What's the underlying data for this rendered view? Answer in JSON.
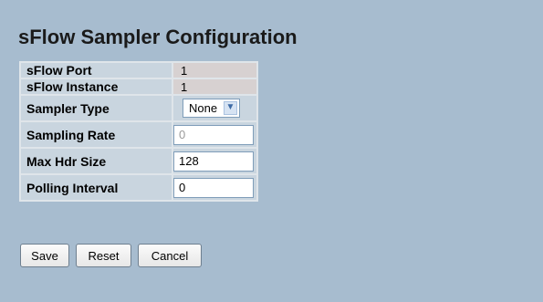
{
  "title": "sFlow Sampler Configuration",
  "form": {
    "rows": [
      {
        "label": "sFlow Port",
        "value": "1"
      },
      {
        "label": "sFlow Instance",
        "value": "1"
      },
      {
        "label": "Sampler Type",
        "value": "None"
      },
      {
        "label": "Sampling Rate",
        "value": "0"
      },
      {
        "label": "Max Hdr Size",
        "value": "128"
      },
      {
        "label": "Polling Interval",
        "value": "0"
      }
    ]
  },
  "buttons": {
    "save": "Save",
    "reset": "Reset",
    "cancel": "Cancel"
  },
  "icons": {
    "select_arrow": "chevron-down-icon"
  },
  "colors": {
    "page_background": "#a7bccf",
    "table_background": "#dfe5ea",
    "label_cell_background": "#c9d5df",
    "readonly_value_background": "#d7d1d1"
  }
}
